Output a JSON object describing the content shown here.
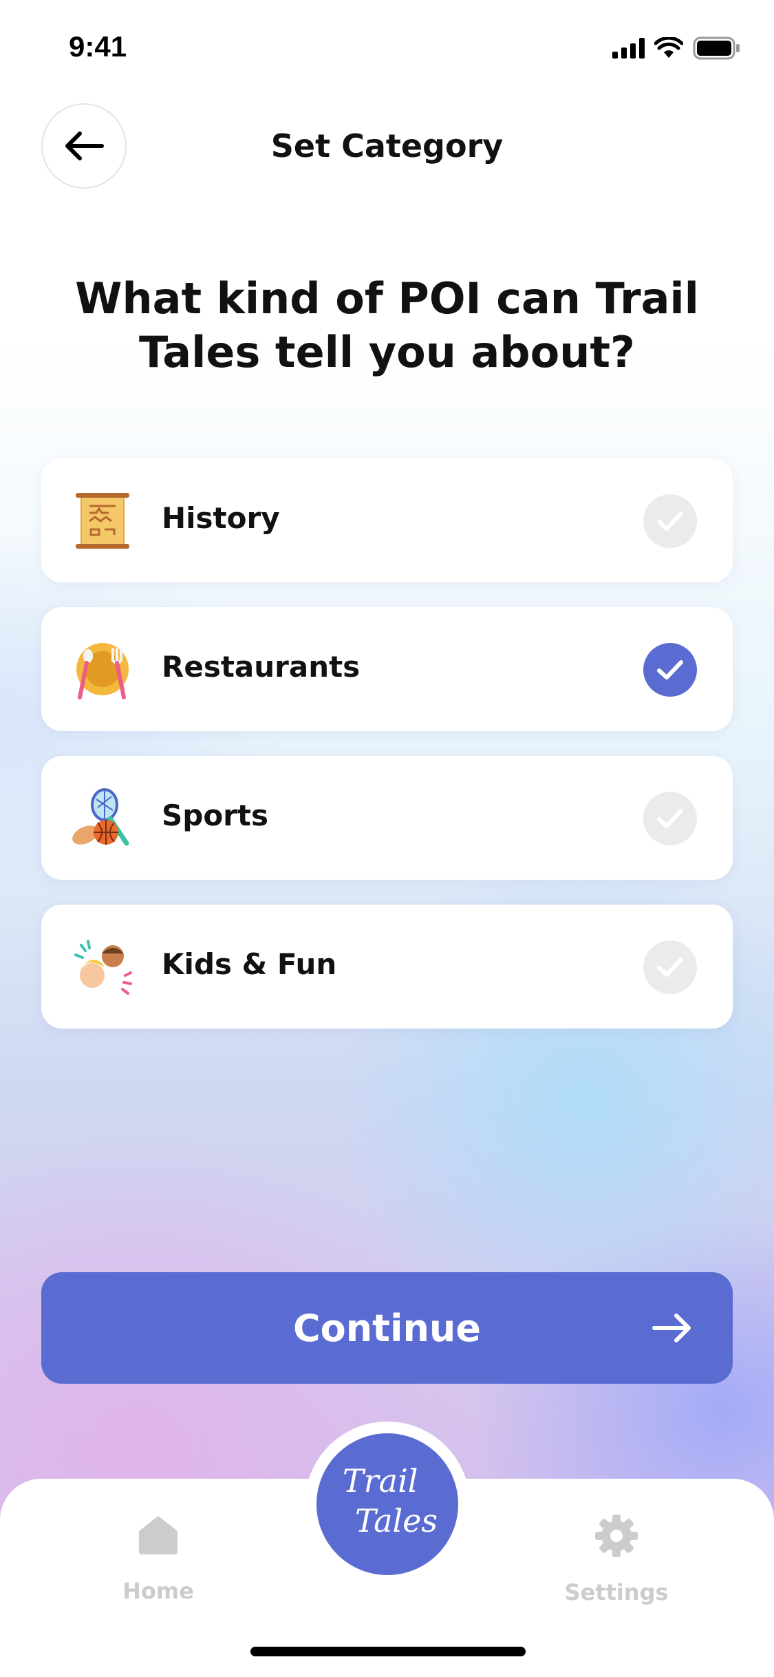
{
  "status_bar": {
    "time": "9:41"
  },
  "header": {
    "title": "Set Category",
    "back_icon": "arrow-left-icon"
  },
  "question": {
    "strong": "What kind of POI",
    "rest": " can Trail Tales tell you about?"
  },
  "categories": [
    {
      "label": "History",
      "icon": "scroll-icon",
      "checked": false
    },
    {
      "label": "Restaurants",
      "icon": "plate-cutlery-icon",
      "checked": true
    },
    {
      "label": "Sports",
      "icon": "sports-balls-icon",
      "checked": false
    },
    {
      "label": "Kids & Fun",
      "icon": "kids-icon",
      "checked": false
    }
  ],
  "continue_button": {
    "label": "Continue"
  },
  "tab_bar": {
    "home": {
      "label": "Home",
      "icon": "home-icon"
    },
    "logo": {
      "line1": "Trail",
      "line2": "Tales"
    },
    "settings": {
      "label": "Settings",
      "icon": "gear-icon"
    }
  },
  "colors": {
    "accent": "#5a6bd1",
    "check_unselected": "#ebebeb",
    "tab_inactive": "#cccccc"
  }
}
